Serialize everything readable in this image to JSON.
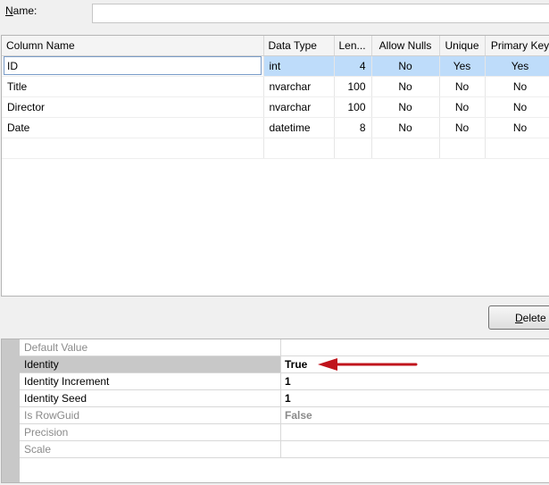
{
  "name_label_accel": "N",
  "name_label_rest": "ame:",
  "name_value": "",
  "columns": {
    "headers": [
      "Column Name",
      "Data Type",
      "Len...",
      "Allow Nulls",
      "Unique",
      "Primary Key"
    ],
    "rows": [
      {
        "name": "ID",
        "type": "int",
        "length": "4",
        "nulls": "No",
        "unique": "Yes",
        "pk": "Yes"
      },
      {
        "name": "Title",
        "type": "nvarchar",
        "length": "100",
        "nulls": "No",
        "unique": "No",
        "pk": "No"
      },
      {
        "name": "Director",
        "type": "nvarchar",
        "length": "100",
        "nulls": "No",
        "unique": "No",
        "pk": "No"
      },
      {
        "name": "Date",
        "type": "datetime",
        "length": "8",
        "nulls": "No",
        "unique": "No",
        "pk": "No"
      }
    ]
  },
  "delete_button": {
    "accel": "D",
    "rest": "elete"
  },
  "properties": [
    {
      "name": "Default Value",
      "value": ""
    },
    {
      "name": "Identity",
      "value": "True"
    },
    {
      "name": "Identity Increment",
      "value": "1"
    },
    {
      "name": "Identity Seed",
      "value": "1"
    },
    {
      "name": "Is RowGuid",
      "value": "False"
    },
    {
      "name": "Precision",
      "value": ""
    },
    {
      "name": "Scale",
      "value": ""
    }
  ],
  "colors": {
    "selection": "#bedcfa",
    "arrow": "#c0141c",
    "gutter": "#c8c8c8"
  }
}
